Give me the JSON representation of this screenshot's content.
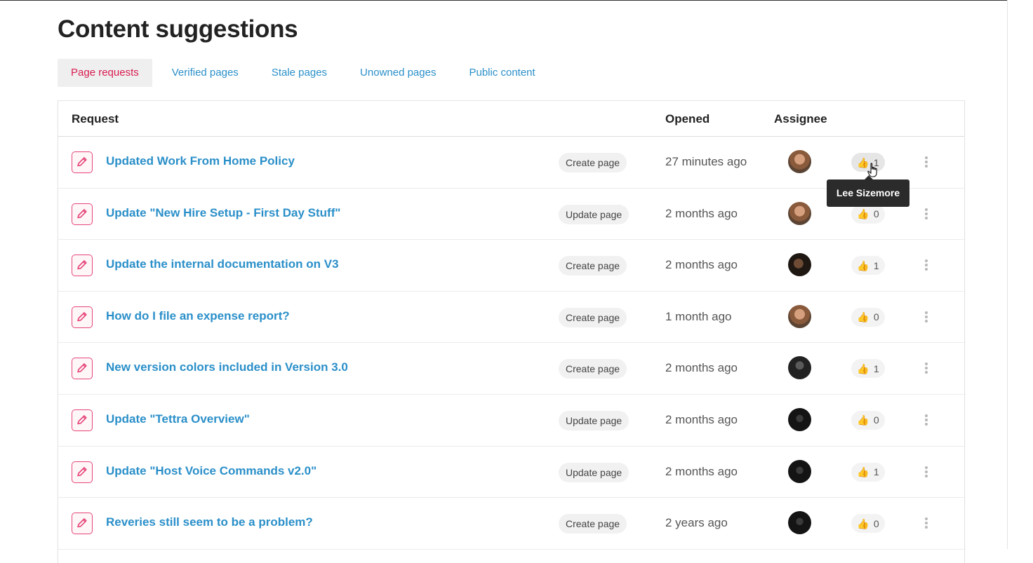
{
  "page": {
    "title": "Content suggestions"
  },
  "tabs": [
    {
      "label": "Page requests",
      "active": true
    },
    {
      "label": "Verified pages",
      "active": false
    },
    {
      "label": "Stale pages",
      "active": false
    },
    {
      "label": "Unowned pages",
      "active": false
    },
    {
      "label": "Public content",
      "active": false
    }
  ],
  "table": {
    "headers": {
      "request": "Request",
      "opened": "Opened",
      "assignee": "Assignee"
    },
    "rows": [
      {
        "title": "Updated Work From Home Policy",
        "action": "Create page",
        "opened": "27 minutes ago",
        "votes": "1"
      },
      {
        "title": "Update \"New Hire Setup - First Day Stuff\"",
        "action": "Update page",
        "opened": "2 months ago",
        "votes": "0"
      },
      {
        "title": "Update the internal documentation on V3",
        "action": "Create page",
        "opened": "2 months ago",
        "votes": "1"
      },
      {
        "title": "How do I file an expense report?",
        "action": "Create page",
        "opened": "1 month ago",
        "votes": "0"
      },
      {
        "title": "New version colors included in Version 3.0",
        "action": "Create page",
        "opened": "2 months ago",
        "votes": "1"
      },
      {
        "title": "Update \"Tettra Overview\"",
        "action": "Update page",
        "opened": "2 months ago",
        "votes": "0"
      },
      {
        "title": "Update \"Host Voice Commands v2.0\"",
        "action": "Update page",
        "opened": "2 months ago",
        "votes": "1"
      },
      {
        "title": "Reveries still seem to be a problem?",
        "action": "Create page",
        "opened": "2 years ago",
        "votes": "0"
      }
    ]
  },
  "tooltip": {
    "text": "Lee Sizemore"
  },
  "icons": {
    "request": "edit-document-icon",
    "vote": "thumbs-up-icon",
    "menu": "kebab-menu-icon"
  },
  "colors": {
    "link": "#2a8fc9",
    "active_tab": "#d81b50",
    "icon": "#e5457a",
    "thumb": "#f3b41d"
  }
}
